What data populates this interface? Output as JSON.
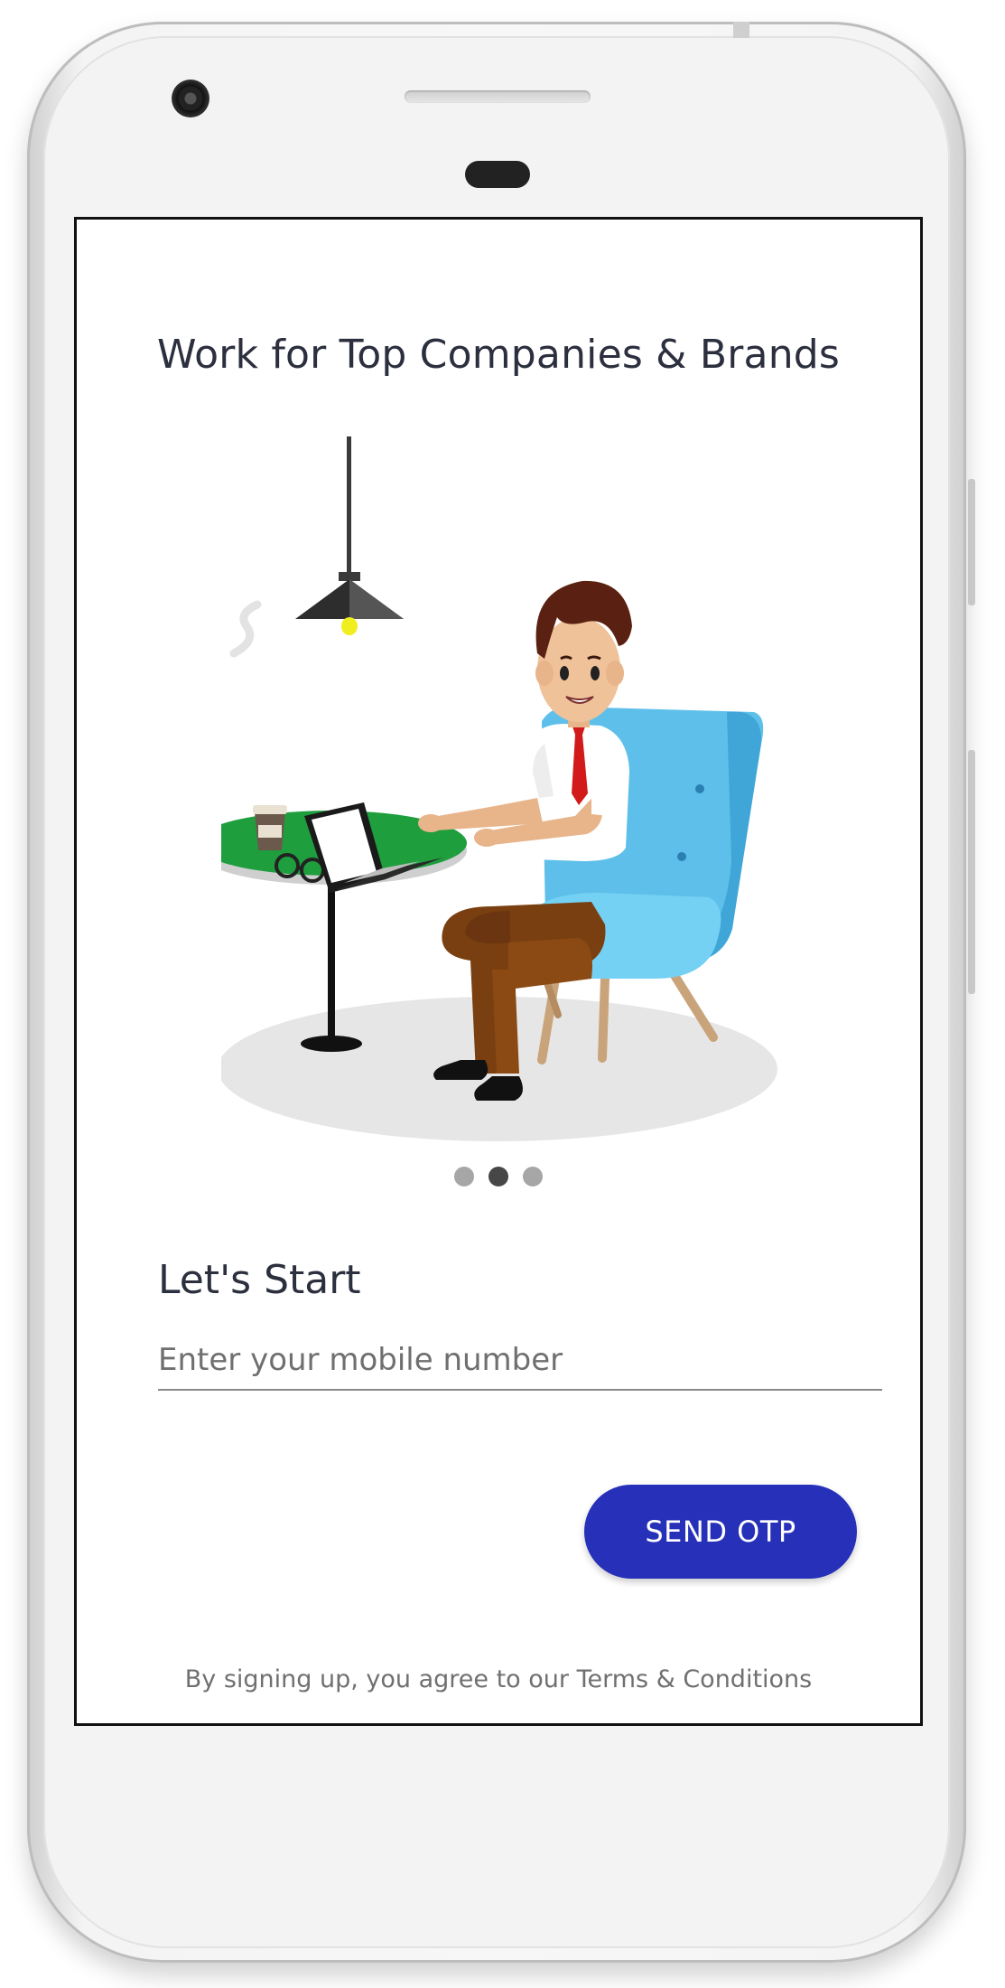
{
  "onboarding": {
    "headline": "Work for Top Companies & Brands",
    "illustration_icon": "man-working-on-laptop-illustration",
    "carousel": {
      "total": 3,
      "active_index": 1
    }
  },
  "login": {
    "heading": "Let's Start",
    "mobile_placeholder": "Enter your mobile number",
    "mobile_value": "",
    "send_otp_label": "SEND OTP",
    "terms_text": "By signing up, you agree to our Terms & Conditions"
  },
  "colors": {
    "primary_button": "#2630b8",
    "text_dark": "#2b2f3e",
    "text_muted": "#707070",
    "dot_active": "#474747",
    "dot_inactive": "#a6a6a6"
  }
}
